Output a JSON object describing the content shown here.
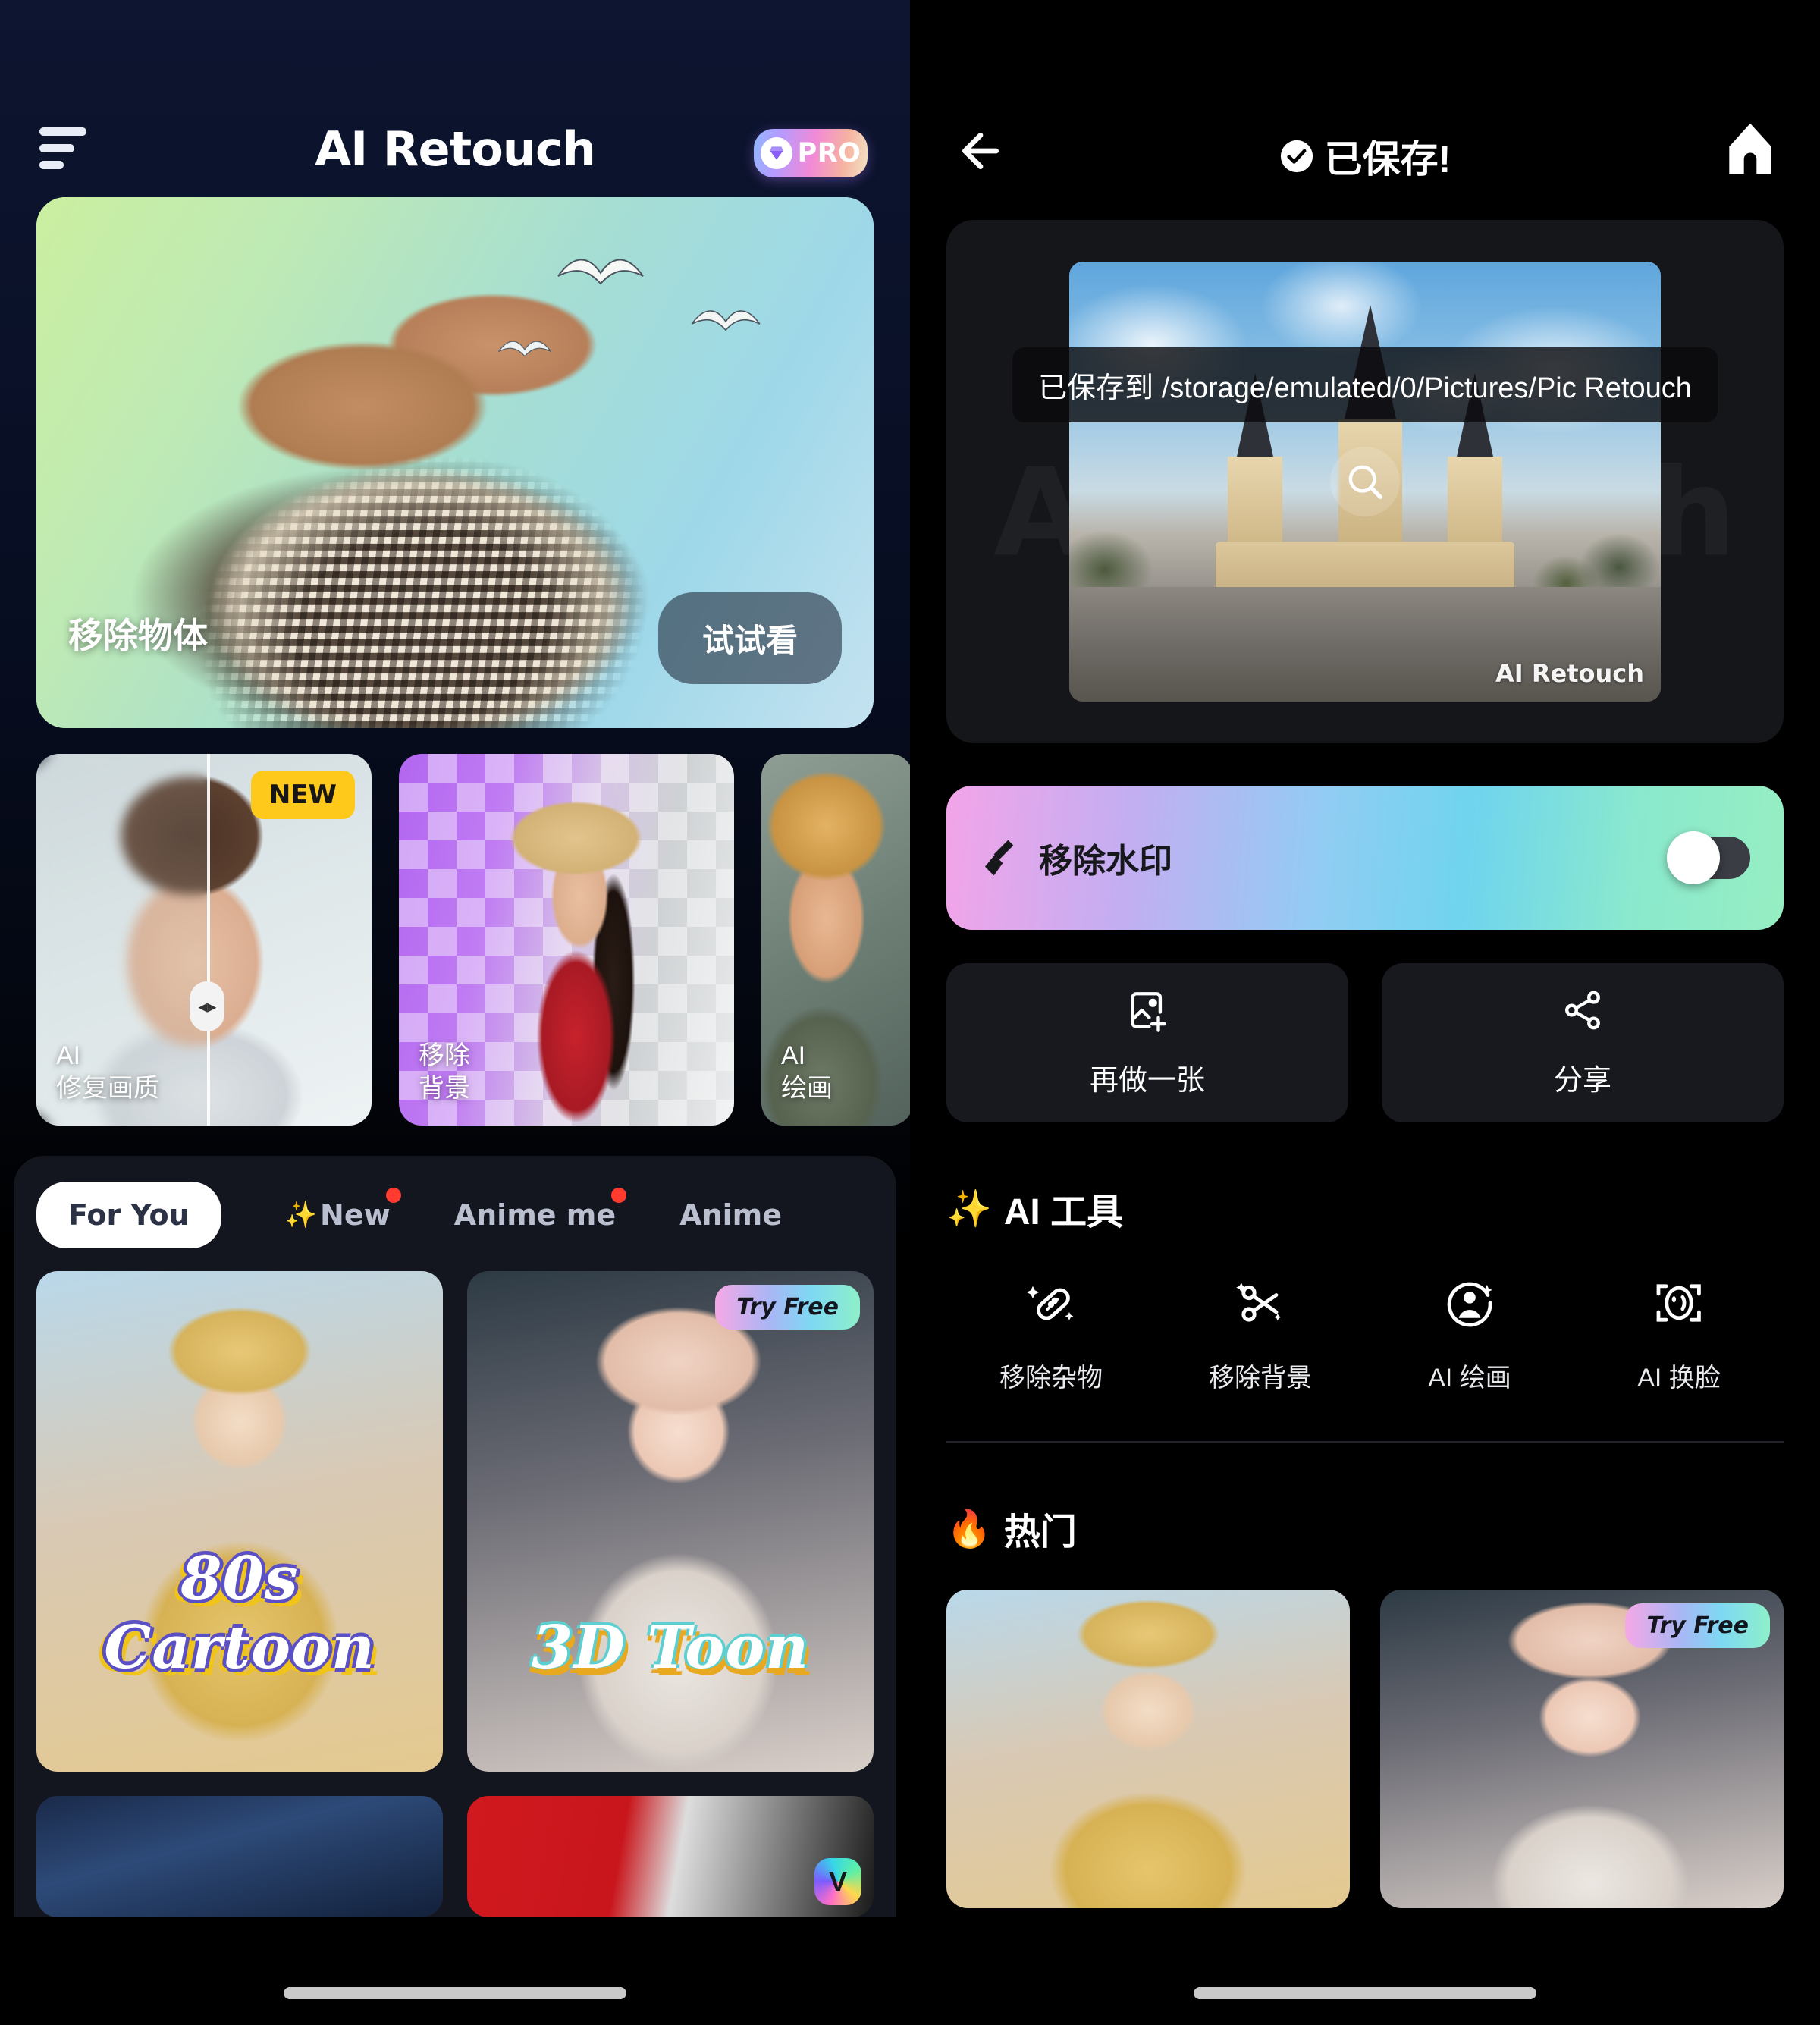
{
  "left": {
    "header": {
      "menu_icon": "hamburger-icon",
      "title": "AI Retouch",
      "pro_label": "PRO",
      "pro_icon": "diamond-icon"
    },
    "hero": {
      "label": "移除物体",
      "cta": "试试看"
    },
    "feature_cards": [
      {
        "badge": "NEW",
        "line1": "AI",
        "line2": "修复画质",
        "icon": "compare-slider-icon"
      },
      {
        "badge": "",
        "line1": "移除",
        "line2": "背景",
        "icon": "checker-transparency-icon"
      },
      {
        "badge": "",
        "line1": "AI",
        "line2": "绘画",
        "icon": "anime-art-icon"
      }
    ],
    "tabs": [
      {
        "label": "For You",
        "active": true,
        "dot": false,
        "sparkle": false
      },
      {
        "label": "New",
        "active": false,
        "dot": true,
        "sparkle": true
      },
      {
        "label": "Anime me",
        "active": false,
        "dot": true,
        "sparkle": false
      },
      {
        "label": "Anime",
        "active": false,
        "dot": false,
        "sparkle": false
      }
    ],
    "gallery": [
      {
        "title": "80s Cartoon",
        "badge": ""
      },
      {
        "title": "3D Toon",
        "badge": "Try Free"
      },
      {
        "title": "",
        "badge": ""
      },
      {
        "title": "",
        "badge": "",
        "logo": "v-logo"
      }
    ]
  },
  "right": {
    "header": {
      "back_icon": "back-arrow-icon",
      "check_icon": "check-circle-icon",
      "title": "已保存!",
      "home_icon": "home-icon"
    },
    "preview": {
      "ghost_watermark": "AI Retouch",
      "saved_path": "已保存到 /storage/emulated/0/Pictures/Pic Retouch",
      "image_watermark": "AI Retouch",
      "zoom_icon": "magnifier-icon"
    },
    "watermark_row": {
      "icon": "broom-icon",
      "label": "移除水印",
      "toggle_on": false
    },
    "actions": [
      {
        "icon": "image-plus-icon",
        "label": "再做一张"
      },
      {
        "icon": "share-icon",
        "label": "分享"
      }
    ],
    "ai_tools": {
      "emoji": "✨",
      "title": "AI 工具",
      "items": [
        {
          "icon": "bandaid-sparkle-icon",
          "label": "移除杂物"
        },
        {
          "icon": "scissors-sparkle-icon",
          "label": "移除背景"
        },
        {
          "icon": "person-sparkle-icon",
          "label": "AI 绘画"
        },
        {
          "icon": "face-swap-icon",
          "label": "AI 换脸"
        }
      ]
    },
    "hot": {
      "emoji": "🔥",
      "title": "热门",
      "items": [
        {
          "badge": ""
        },
        {
          "badge": "Try Free"
        }
      ]
    }
  },
  "colors": {
    "accent_yellow": "#ffc91c",
    "red_dot": "#ff3b30",
    "sheet_bg": "#14161f",
    "card_bg": "#17191f",
    "gradient_start": "#f3a4e8",
    "gradient_mid": "#6fd4ee",
    "gradient_end": "#96eec2"
  }
}
